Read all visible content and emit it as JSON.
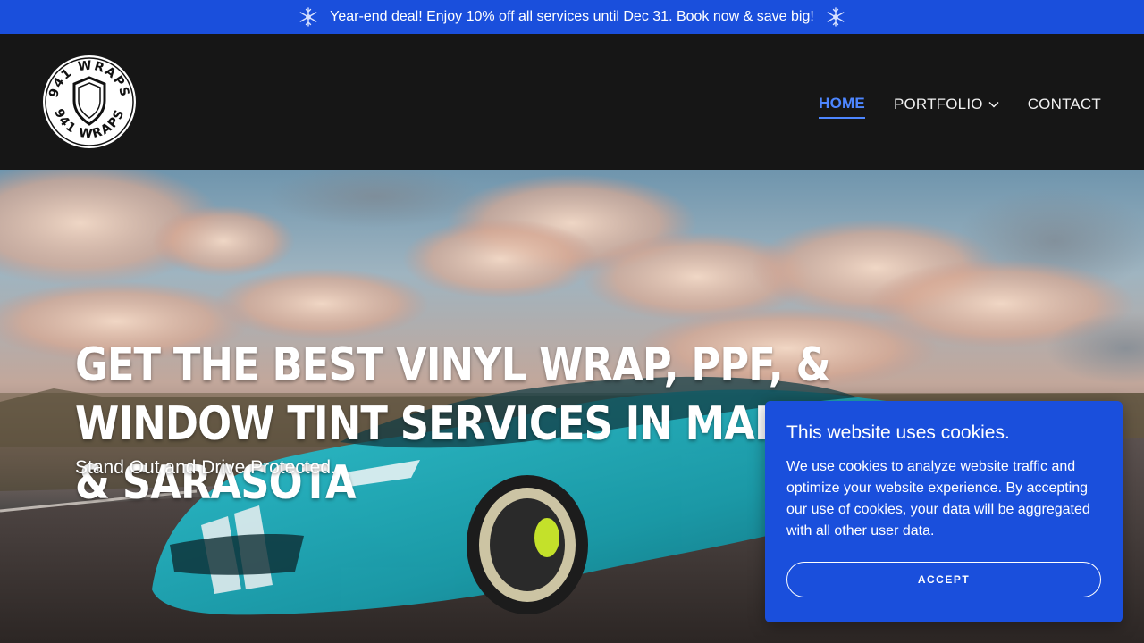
{
  "promo": {
    "text": "Year-end deal! Enjoy 10% off all services until Dec 31. Book now & save big!",
    "icon": "snowflake-icon",
    "bg_color": "#1a4fdc"
  },
  "header": {
    "logo_text_top": "941 WRAPS",
    "logo_text_bottom": "941 WRAPS",
    "nav": {
      "home": "HOME",
      "portfolio": "PORTFOLIO",
      "contact": "CONTACT"
    },
    "active_color": "#4d86ff"
  },
  "hero": {
    "title": "GET THE BEST VINYL WRAP, PPF, & WINDOW TINT SERVICES IN MANATEE & SARASOTA",
    "subtitle": "Stand Out and Drive Protected."
  },
  "cookie": {
    "title": "This website uses cookies.",
    "body": "We use cookies to analyze website traffic and optimize your website experience. By accepting our use of cookies, your data will be aggregated with all other user data.",
    "accept_label": "ACCEPT"
  }
}
